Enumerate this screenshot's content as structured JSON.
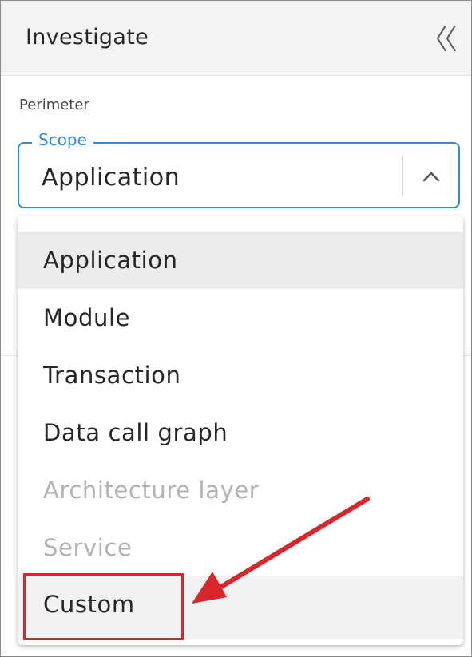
{
  "panel": {
    "title": "Investigate",
    "collapse_icon": "double-chevron-left-icon"
  },
  "perimeter": {
    "section_label": "Perimeter",
    "scope": {
      "legend": "Scope",
      "value": "Application",
      "toggle_icon": "chevron-up-icon",
      "options": [
        {
          "label": "Application",
          "state": "selected"
        },
        {
          "label": "Module",
          "state": "enabled"
        },
        {
          "label": "Transaction",
          "state": "enabled"
        },
        {
          "label": "Data call graph",
          "state": "enabled"
        },
        {
          "label": "Architecture layer",
          "state": "disabled"
        },
        {
          "label": "Service",
          "state": "disabled"
        },
        {
          "label": "Custom",
          "state": "enabled"
        }
      ]
    }
  },
  "annotation": {
    "highlight_color": "#d9262c",
    "target": "Custom"
  },
  "colors": {
    "accent": "#2f8bd9",
    "disabled_text": "#b3b3b3",
    "selected_bg": "#ececec"
  }
}
